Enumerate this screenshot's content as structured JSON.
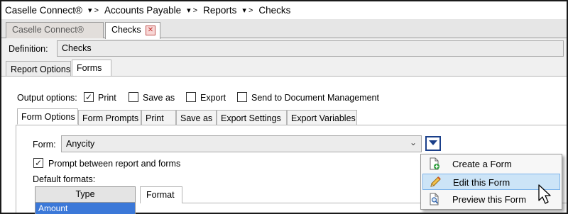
{
  "breadcrumb": {
    "items": [
      "Caselle Connect®",
      "Accounts Payable",
      "Reports",
      "Checks"
    ],
    "separator": "▾ >"
  },
  "doc_tabs": [
    {
      "label": "Caselle Connect®",
      "active": false
    },
    {
      "label": "Checks",
      "active": true,
      "close_icon": "close-icon"
    }
  ],
  "definition": {
    "label": "Definition:",
    "value": "Checks"
  },
  "option_tabs": [
    "Report Options",
    "Forms"
  ],
  "output_options": {
    "label": "Output options:",
    "items": [
      {
        "label": "Print",
        "checked": true
      },
      {
        "label": "Save as",
        "checked": false
      },
      {
        "label": "Export",
        "checked": false
      },
      {
        "label": "Send to Document Management",
        "checked": false
      }
    ]
  },
  "inner_tabs": [
    "Form Options",
    "Form Prompts",
    "Print",
    "Save as",
    "Export Settings",
    "Export Variables"
  ],
  "form": {
    "label": "Form:",
    "value": "Anycity",
    "prompt_label": "Prompt between report and forms",
    "prompt_checked": true,
    "defaults_label": "Default formats:"
  },
  "formats_grid": {
    "header": "Type",
    "rows": [
      "Amount"
    ]
  },
  "format_tab": "Format",
  "menu": {
    "items": [
      {
        "label": "Create a Form",
        "icon": "document-add-icon"
      },
      {
        "label": "Edit this Form",
        "icon": "pencil-icon",
        "highlighted": true
      },
      {
        "label": "Preview this Form",
        "icon": "document-search-icon"
      }
    ]
  },
  "colors": {
    "accent": "#1a3f8a",
    "selection": "#3b78d8",
    "menu_highlight": "#cce4f7",
    "close": "#c0504d"
  }
}
